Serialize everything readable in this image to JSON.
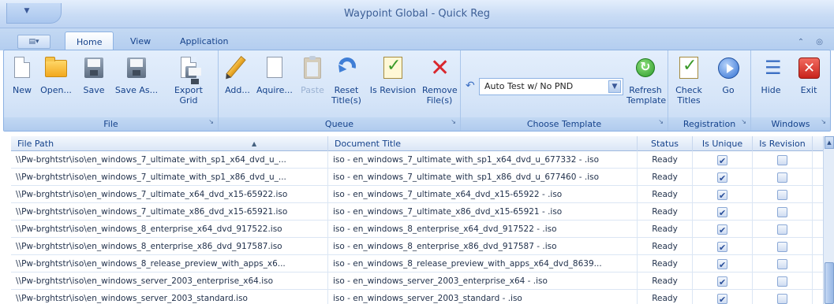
{
  "window": {
    "title": "Waypoint Global - Quick Reg"
  },
  "quick_access": {
    "icon": "dropdown-arrow-icon"
  },
  "tabs": [
    {
      "label": "Home",
      "active": true
    },
    {
      "label": "View",
      "active": false
    },
    {
      "label": "Application",
      "active": false
    }
  ],
  "ribbon": {
    "file": {
      "label": "File",
      "new": "New",
      "open": "Open...",
      "save": "Save",
      "save_as": "Save As...",
      "export_grid_line1": "Export",
      "export_grid_line2": "Grid"
    },
    "queue": {
      "label": "Queue",
      "add": "Add...",
      "aquire": "Aquire...",
      "paste": "Paste",
      "reset_line1": "Reset",
      "reset_line2": "Title(s)",
      "is_revision": "Is Revision",
      "remove_line1": "Remove",
      "remove_line2": "File(s)"
    },
    "choose_template": {
      "label": "Choose Template",
      "selected": "Auto Test w/ No PND",
      "refresh_line1": "Refresh",
      "refresh_line2": "Template"
    },
    "registration": {
      "label": "Registration",
      "check_line1": "Check",
      "check_line2": "Titles",
      "go": "Go"
    },
    "windows": {
      "label": "Windows",
      "hide": "Hide",
      "exit": "Exit"
    }
  },
  "grid": {
    "columns": {
      "file_path": "File Path",
      "document_title": "Document Title",
      "status": "Status",
      "is_unique": "Is Unique",
      "is_revision": "Is Revision"
    },
    "rows": [
      {
        "file_path": "\\\\Pw-brghtstr\\iso\\en_windows_7_ultimate_with_sp1_x64_dvd_u_...",
        "document_title": "iso - en_windows_7_ultimate_with_sp1_x64_dvd_u_677332 - .iso",
        "status": "Ready",
        "is_unique": true,
        "is_revision": false
      },
      {
        "file_path": "\\\\Pw-brghtstr\\iso\\en_windows_7_ultimate_with_sp1_x86_dvd_u_...",
        "document_title": "iso - en_windows_7_ultimate_with_sp1_x86_dvd_u_677460 - .iso",
        "status": "Ready",
        "is_unique": true,
        "is_revision": false
      },
      {
        "file_path": "\\\\Pw-brghtstr\\iso\\en_windows_7_ultimate_x64_dvd_x15-65922.iso",
        "document_title": "iso - en_windows_7_ultimate_x64_dvd_x15-65922 - .iso",
        "status": "Ready",
        "is_unique": true,
        "is_revision": false
      },
      {
        "file_path": "\\\\Pw-brghtstr\\iso\\en_windows_7_ultimate_x86_dvd_x15-65921.iso",
        "document_title": "iso - en_windows_7_ultimate_x86_dvd_x15-65921 - .iso",
        "status": "Ready",
        "is_unique": true,
        "is_revision": false
      },
      {
        "file_path": "\\\\Pw-brghtstr\\iso\\en_windows_8_enterprise_x64_dvd_917522.iso",
        "document_title": "iso - en_windows_8_enterprise_x64_dvd_917522 - .iso",
        "status": "Ready",
        "is_unique": true,
        "is_revision": false
      },
      {
        "file_path": "\\\\Pw-brghtstr\\iso\\en_windows_8_enterprise_x86_dvd_917587.iso",
        "document_title": "iso - en_windows_8_enterprise_x86_dvd_917587 - .iso",
        "status": "Ready",
        "is_unique": true,
        "is_revision": false
      },
      {
        "file_path": "\\\\Pw-brghtstr\\iso\\en_windows_8_release_preview_with_apps_x6...",
        "document_title": "iso - en_windows_8_release_preview_with_apps_x64_dvd_8639...",
        "status": "Ready",
        "is_unique": true,
        "is_revision": false
      },
      {
        "file_path": "\\\\Pw-brghtstr\\iso\\en_windows_server_2003_enterprise_x64.iso",
        "document_title": "iso - en_windows_server_2003_enterprise_x64 - .iso",
        "status": "Ready",
        "is_unique": true,
        "is_revision": false
      },
      {
        "file_path": "\\\\Pw-brghtstr\\iso\\en_windows_server_2003_standard.iso",
        "document_title": "iso - en_windows_server_2003_standard - .iso",
        "status": "Ready",
        "is_unique": true,
        "is_revision": false
      }
    ]
  },
  "colors": {
    "accent": "#15428b",
    "ribbon": "#d6e5f8",
    "exit": "#c8231b",
    "go": "#2f6fd2"
  }
}
